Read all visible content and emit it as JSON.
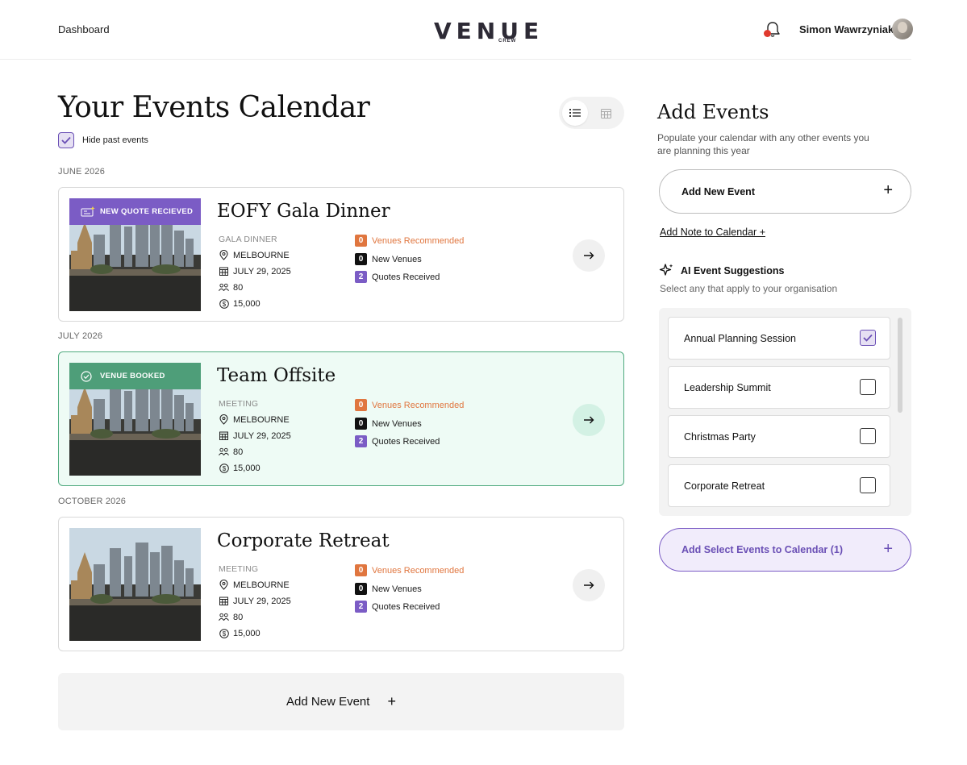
{
  "header": {
    "nav_dashboard": "Dashboard",
    "logo_text": "VENUE",
    "logo_sub": "CREW",
    "user_name": "Simon Wawrzyniak"
  },
  "calendar": {
    "title": "Your Events Calendar",
    "hide_past_label": "Hide past events",
    "hide_past_checked": true,
    "view_mode": "list",
    "months": [
      "JUNE 2026",
      "JULY 2026",
      "OCTOBER 2026"
    ],
    "events": [
      {
        "name": "EOFY Gala Dinner",
        "badge": "NEW QUOTE RECIEVED",
        "badge_type": "quote",
        "type": "GALA DINNER",
        "location": "MELBOURNE",
        "date": "JULY 29, 2025",
        "guests": "80",
        "budget": "15,000",
        "venues_recommended": "0",
        "venues_recommended_label": "Venues Recommended",
        "new_venues": "0",
        "new_venues_label": "New Venues",
        "quotes_received": "2",
        "quotes_received_label": "Quotes Received"
      },
      {
        "name": "Team Offsite",
        "badge": "VENUE BOOKED",
        "badge_type": "booked",
        "type": "MEETING",
        "location": "MELBOURNE",
        "date": "JULY 29, 2025",
        "guests": "80",
        "budget": "15,000",
        "venues_recommended": "0",
        "venues_recommended_label": "Venues Recommended",
        "new_venues": "0",
        "new_venues_label": "New Venues",
        "quotes_received": "2",
        "quotes_received_label": "Quotes Received"
      },
      {
        "name": "Corporate Retreat",
        "badge": "",
        "badge_type": "none",
        "type": "MEETING",
        "location": "MELBOURNE",
        "date": "JULY 29, 2025",
        "guests": "80",
        "budget": "15,000",
        "venues_recommended": "0",
        "venues_recommended_label": "Venues Recommended",
        "new_venues": "0",
        "new_venues_label": "New Venues",
        "quotes_received": "2",
        "quotes_received_label": "Quotes Received"
      }
    ],
    "add_new_event": "Add New Event"
  },
  "sidebar": {
    "title": "Add Events",
    "description": "Populate your calendar with any other events you are planning this year",
    "add_new_event": "Add New Event",
    "add_note": "Add Note to Calendar +",
    "ai_title": "AI Event Suggestions",
    "ai_subtitle": "Select any that apply to your organisation",
    "suggestions": [
      {
        "label": "Annual Planning Session",
        "checked": true
      },
      {
        "label": "Leadership Summit",
        "checked": false
      },
      {
        "label": "Christmas Party",
        "checked": false
      },
      {
        "label": "Corporate Retreat",
        "checked": false
      }
    ],
    "add_selected": "Add Select Events to Calendar (1)"
  },
  "colors": {
    "accent_purple": "#7b5cc5",
    "booked_green": "#4e9e79",
    "orange": "#e0763f"
  }
}
